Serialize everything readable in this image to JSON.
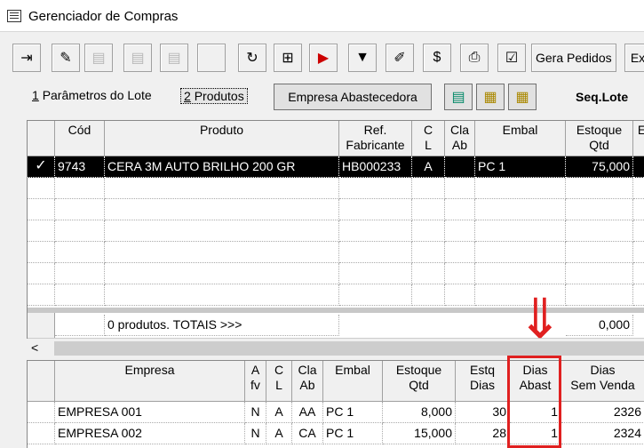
{
  "window": {
    "title": "Gerenciador de Compras"
  },
  "toolbar": {
    "icons": [
      "exit-icon",
      "eraser-icon",
      "disabled-icon",
      "disabled-icon",
      "disabled-icon",
      "blank-icon",
      "refresh-icon",
      "add-icon",
      "remove-icon",
      "filter-icon",
      "edit-icon",
      "price-icon",
      "print-icon",
      "check-icon"
    ],
    "gera_pedidos": "Gera Pedidos",
    "ex": "Ex"
  },
  "tabs": [
    {
      "num": "1",
      "label": "Parâmetros do Lote"
    },
    {
      "num": "2",
      "label": "Produtos"
    }
  ],
  "empresa_btn": "Empresa Abastecedora",
  "seq_label": "Seq.Lote",
  "products": {
    "headers": [
      "Cód",
      "Produto",
      "Ref.\nFabricante",
      "C\nL",
      "Cla\nAb",
      "Embal",
      "Estoque\nQtd",
      "E"
    ],
    "rows": [
      {
        "check": "✓",
        "cod": "9743",
        "produto": "CERA 3M AUTO BRILHO 200 GR",
        "ref": "HB000233",
        "cl": "A",
        "claab": "",
        "embal": "PC 1",
        "estoque": "75,000"
      }
    ],
    "footer_label": "0 produtos. TOTAIS >>>",
    "footer_total": "0,000"
  },
  "scroll": {
    "left_arrow": "<"
  },
  "companies": {
    "headers": [
      "Empresa",
      "A\nfv",
      "C\nL",
      "Cla\nAb",
      "Embal",
      "Estoque\nQtd",
      "Estq\nDias",
      "Dias\nAbast",
      "Dias\nSem Venda"
    ],
    "rows": [
      {
        "empresa": "EMPRESA 001",
        "afv": "N",
        "cl": "A",
        "claab": "AA",
        "embal": "PC 1",
        "estoque": "8,000",
        "estq_dias": "30",
        "dias_abast": "1",
        "sem_venda": "2326"
      },
      {
        "empresa": "EMPRESA 002",
        "afv": "N",
        "cl": "A",
        "claab": "CA",
        "embal": "PC 1",
        "estoque": "15,000",
        "estq_dias": "28",
        "dias_abast": "1",
        "sem_venda": "2324"
      }
    ]
  },
  "annotation": {
    "arrow": "⇓"
  },
  "colors": {
    "highlight": "#e02020",
    "selected_row": "#000000"
  }
}
